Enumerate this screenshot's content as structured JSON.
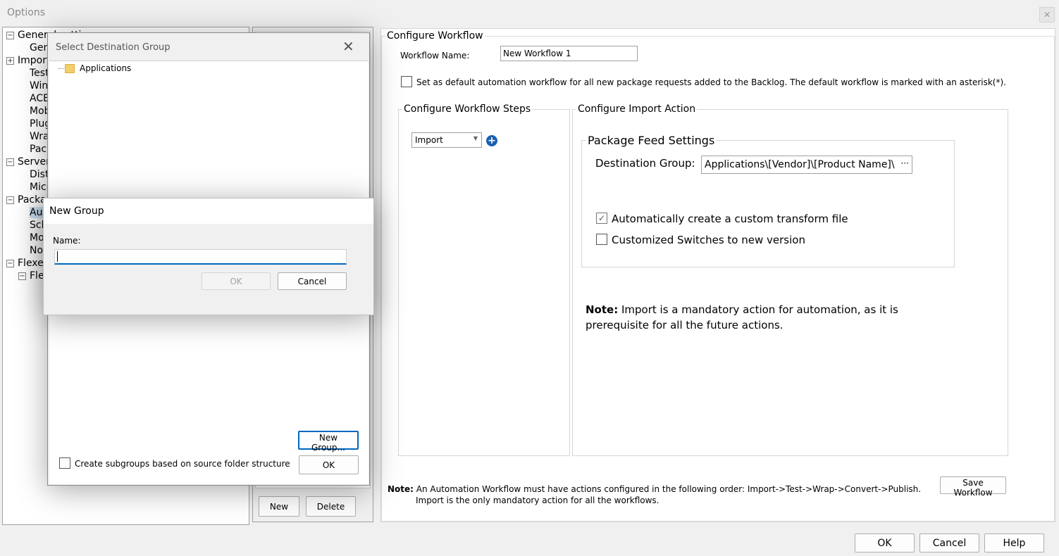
{
  "window": {
    "title": "Options",
    "close_icon": "close-icon"
  },
  "tree": {
    "items": [
      {
        "label": "General settings",
        "expander": "−"
      },
      {
        "label": "General"
      },
      {
        "label": "Import",
        "expander": "+"
      },
      {
        "label": "Test"
      },
      {
        "label": "Windows"
      },
      {
        "label": "ACE"
      },
      {
        "label": "Mobile"
      },
      {
        "label": "Plugins"
      },
      {
        "label": "Wrap"
      },
      {
        "label": "Package"
      },
      {
        "label": "Server",
        "expander": "−"
      },
      {
        "label": "Distribution"
      },
      {
        "label": "Microsoft"
      },
      {
        "label": "Package",
        "expander": "−"
      },
      {
        "label": "Automation"
      },
      {
        "label": "Schedule"
      },
      {
        "label": "Monitor"
      },
      {
        "label": "Notification"
      },
      {
        "label": "Flexera",
        "expander": "−"
      },
      {
        "label": "Flexera",
        "expander": "−"
      }
    ]
  },
  "workflow_list": {
    "new_label": "New",
    "delete_label": "Delete"
  },
  "configure_workflow": {
    "legend": "Configure Workflow",
    "name_label": "Workflow Name:",
    "name_value": "New Workflow 1",
    "default_checkbox_label": "Set as default automation workflow for all new package requests added to the Backlog. The default workflow is marked with an asterisk(*).",
    "steps_legend": "Configure Workflow Steps",
    "step_select_value": "Import",
    "import_action_legend": "Configure Import Action",
    "feed_legend": "Package Feed Settings",
    "destination_label": "Destination Group:",
    "destination_value": "Applications\\[Vendor]\\[Product Name]\\",
    "browse_label": "···",
    "auto_transform_label": "Automatically create a custom transform file",
    "custom_switches_label": "Customized Switches to new version",
    "note_bold": "Note:",
    "note_line1": " Import is a mandatory action for automation, as it is",
    "note_line2": "prerequisite for all the future actions.",
    "bottom_note_bold": "Note:",
    "bottom_note_line1": " An Automation Workflow must have actions configured in the following order: Import->Test->Wrap->Convert->Publish.",
    "bottom_note_line2": "Import is the only mandatory action for all the workflows.",
    "save_label": "Save Workflow"
  },
  "footer": {
    "ok_label": "OK",
    "cancel_label": "Cancel",
    "help_label": "Help"
  },
  "select_dialog": {
    "title": "Select Destination Group",
    "tree_item": "Applications",
    "new_group_label": "New Group...",
    "subgroups_label": "Create subgroups based on source folder structure",
    "ok_label": "OK"
  },
  "new_group_dialog": {
    "title": "New Group",
    "name_label": "Name:",
    "name_value": "",
    "ok_label": "OK",
    "cancel_label": "Cancel"
  },
  "colors": {
    "accent": "#0067c0",
    "plus_icon": "#1a62b0",
    "folder": "#f3cf6a"
  }
}
